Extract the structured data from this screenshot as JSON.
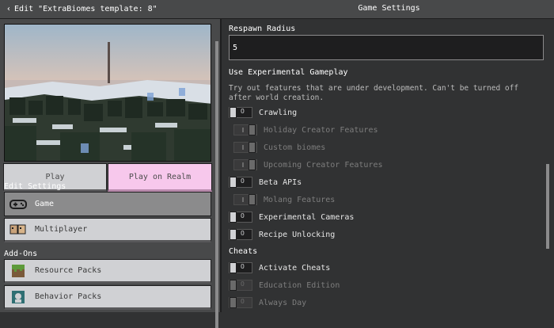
{
  "topbar": {
    "back_label": "Edit \"ExtraBiomes template: 8\"",
    "title": "Game Settings"
  },
  "left": {
    "play_label": "Play",
    "realm_label": "Play on Realm",
    "edit_settings_label": "Edit Settings",
    "addons_label": "Add-Ons",
    "nav": [
      {
        "label": "Game",
        "icon": "controller-icon"
      },
      {
        "label": "Multiplayer",
        "icon": "multiplayer-icon"
      },
      {
        "label": "Resource Packs",
        "icon": "grass-block-icon"
      },
      {
        "label": "Behavior Packs",
        "icon": "behavior-icon"
      }
    ]
  },
  "right": {
    "respawn_radius_label": "Respawn Radius",
    "respawn_radius_value": "5",
    "experimental_label": "Use Experimental Gameplay",
    "experimental_desc": "Try out features that are under development. Can't be turned off after world creation.",
    "toggles": [
      {
        "label": "Crawling",
        "state": "off"
      },
      {
        "label": "Holiday Creator Features",
        "state": "dim"
      },
      {
        "label": "Custom biomes",
        "state": "dim"
      },
      {
        "label": "Upcoming Creator Features",
        "state": "dim"
      },
      {
        "label": "Beta APIs",
        "state": "off"
      },
      {
        "label": "Molang Features",
        "state": "dim"
      },
      {
        "label": "Experimental Cameras",
        "state": "off"
      },
      {
        "label": "Recipe Unlocking",
        "state": "off"
      }
    ],
    "cheats_label": "Cheats",
    "cheats": [
      {
        "label": "Activate Cheats",
        "state": "off"
      },
      {
        "label": "Education Edition",
        "state": "disabled"
      },
      {
        "label": "Always Day",
        "state": "disabled"
      }
    ]
  },
  "colors": {
    "panel": "#48494a",
    "background": "#313233",
    "realm_pink": "#f7c8ec",
    "button_gray": "#d0d1d4"
  }
}
